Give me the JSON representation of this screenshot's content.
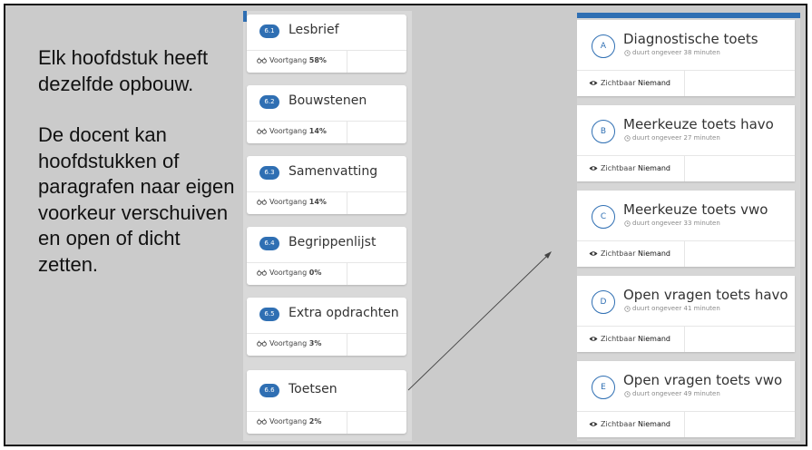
{
  "intro": {
    "paragraph1": "Elk hoofdstuk heeft dezelfde opbouw.",
    "paragraph2": "De docent kan hoofdstukken of paragrafen naar eigen voorkeur verschuiven en open of dicht zetten."
  },
  "chapters": {
    "progress_label": "Voortgang",
    "items": [
      {
        "num": "6.1",
        "title": "Lesbrief",
        "progress": "58%"
      },
      {
        "num": "6.2",
        "title": "Bouwstenen",
        "progress": "14%"
      },
      {
        "num": "6.3",
        "title": "Samenvatting",
        "progress": "14%"
      },
      {
        "num": "6.4",
        "title": "Begrippenlijst",
        "progress": "0%"
      },
      {
        "num": "6.5",
        "title": "Extra opdrachten",
        "progress": "3%"
      },
      {
        "num": "6.6",
        "title": "Toetsen",
        "progress": "2%"
      }
    ]
  },
  "tests": {
    "visible_label": "Zichtbaar",
    "items": [
      {
        "letter": "A",
        "title": "Diagnostische toets",
        "duration": "duurt ongeveer 38 minuten",
        "visible_to": "Niemand"
      },
      {
        "letter": "B",
        "title": "Meerkeuze toets havo",
        "duration": "duurt ongeveer 27 minuten",
        "visible_to": "Niemand"
      },
      {
        "letter": "C",
        "title": "Meerkeuze toets vwo",
        "duration": "duurt ongeveer 33 minuten",
        "visible_to": "Niemand"
      },
      {
        "letter": "D",
        "title": "Open vragen toets havo",
        "duration": "duurt ongeveer 41 minuten",
        "visible_to": "Niemand"
      },
      {
        "letter": "E",
        "title": "Open vragen toets vwo",
        "duration": "duurt ongeveer 49 minuten",
        "visible_to": "Niemand"
      }
    ]
  },
  "colors": {
    "accent": "#2f6fb3",
    "slide_background": "#cbcbcb"
  },
  "icons": {
    "progress": "glasses-icon",
    "visibility": "eye-icon",
    "duration": "clock-icon"
  }
}
